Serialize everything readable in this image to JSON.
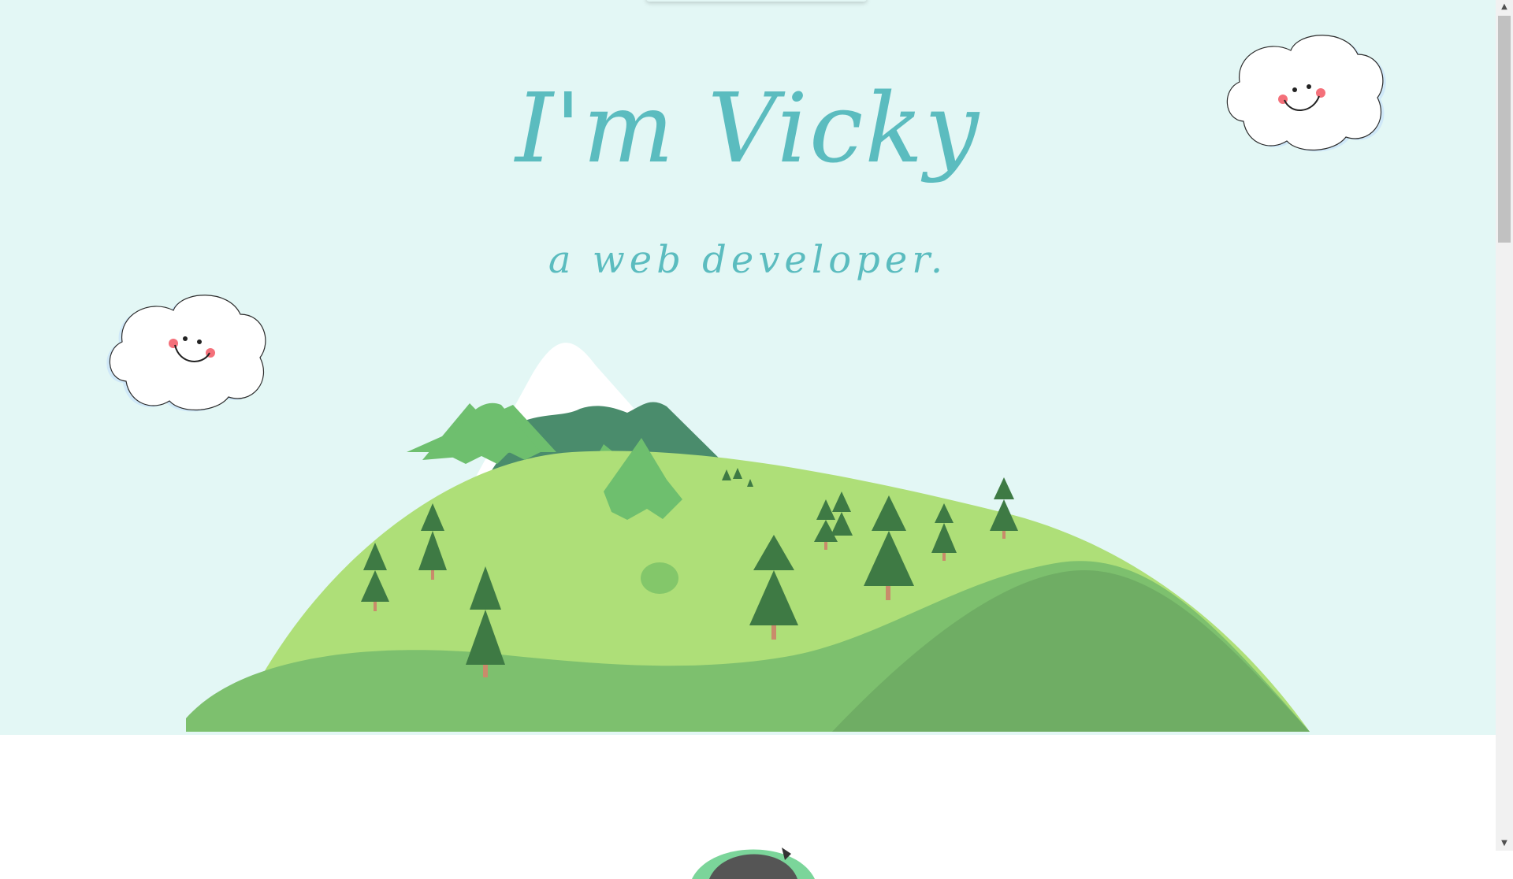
{
  "hero": {
    "title": "I'm Vicky",
    "subtitle": "a web developer."
  },
  "icons": {
    "cloud_right": "smiling-cloud-icon",
    "cloud_left": "smiling-cloud-icon",
    "landscape": "mountain-landscape-illustration",
    "avatar": "avatar-illustration"
  },
  "colors": {
    "hero_background": "#e3f7f5",
    "title_color": "#5bbcbf",
    "page_background": "#ffffff"
  }
}
